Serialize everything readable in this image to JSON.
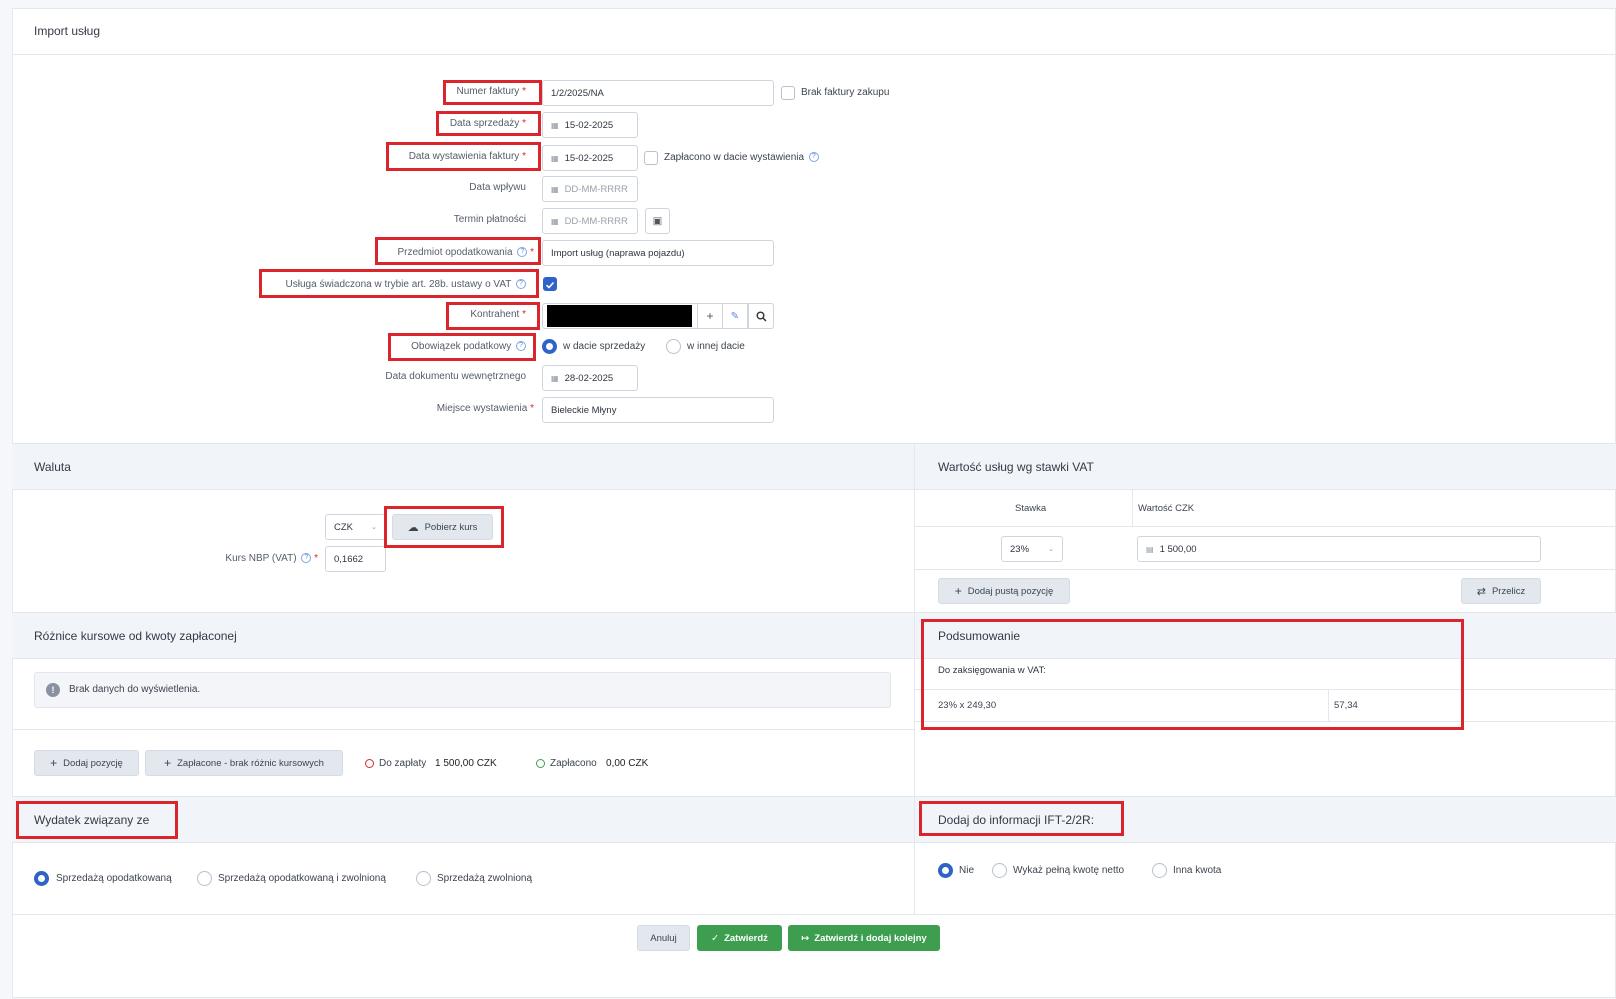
{
  "page": {
    "title": "Import usług"
  },
  "form": {
    "invoice_number": {
      "label": "Numer faktury",
      "value": "1/2/2025/NA",
      "no_invoice_label": "Brak faktury zakupu"
    },
    "sale_date": {
      "label": "Data sprzedaży",
      "value": "15-02-2025"
    },
    "issue_date": {
      "label": "Data wystawienia faktury",
      "value": "15-02-2025",
      "paid_label": "Zapłacono w dacie wystawienia"
    },
    "receipt_date": {
      "label": "Data wpływu",
      "placeholder": "DD-MM-RRRR"
    },
    "payment_term": {
      "label": "Termin płatności",
      "placeholder": "DD-MM-RRRR"
    },
    "subject": {
      "label": "Przedmiot opodatkowania",
      "value": "Import usług (naprawa pojazdu)"
    },
    "service_28b": {
      "label": "Usługa świadczona w trybie art. 28b. ustawy o VAT",
      "checked": true
    },
    "contractor": {
      "label": "Kontrahent"
    },
    "tax_obligation": {
      "label": "Obowiązek podatkowy",
      "opt1": "w dacie sprzedaży",
      "opt2": "w innej dacie",
      "selected": "w dacie sprzedaży"
    },
    "internal_doc_date": {
      "label": "Data dokumentu wewnętrznego",
      "value": "28-02-2025"
    },
    "place": {
      "label": "Miejsce wystawienia",
      "value": "Bieleckie Młyny"
    }
  },
  "currency": {
    "title": "Waluta",
    "code": "CZK",
    "fetch_label": "Pobierz kurs",
    "rate_label": "Kurs NBP (VAT)",
    "rate": "0,1662"
  },
  "vat_values": {
    "title": "Wartość usług wg stawki VAT",
    "col_rate": "Stawka",
    "col_value": "Wartość CZK",
    "rate": "23%",
    "value": "1 500,00",
    "add_label": "Dodaj pustą pozycję",
    "recalc_label": "Przelicz"
  },
  "exchange": {
    "title": "Różnice kursowe od kwoty zapłaconej",
    "empty": "Brak danych do wyświetlenia.",
    "add_label": "Dodaj pozycję",
    "paid_label": "Zapłacone - brak różnic kursowych",
    "to_pay_label": "Do zapłaty",
    "to_pay_value": "1 500,00 CZK",
    "paid_amount_label": "Zapłacono",
    "paid_amount_value": "0,00 CZK"
  },
  "summary": {
    "title": "Podsumowanie",
    "subtitle": "Do zaksięgowania w VAT:",
    "row_label": "23% x 249,30",
    "row_value": "57,34"
  },
  "expense": {
    "title": "Wydatek związany ze",
    "opt1": "Sprzedażą opodatkowaną",
    "opt2": "Sprzedażą opodatkowaną i zwolnioną",
    "opt3": "Sprzedażą zwolnioną"
  },
  "ift": {
    "title": "Dodaj do informacji IFT-2/2R:",
    "opt1": "Nie",
    "opt2": "Wykaż pełną kwotę netto",
    "opt3": "Inna kwota"
  },
  "footer": {
    "cancel": "Anuluj",
    "confirm": "Zatwierdź",
    "confirm_next": "Zatwierdź i dodaj kolejny"
  },
  "colors": {
    "accent": "#2e63c8",
    "highlight": "#d9252b",
    "green": "#3c9e4e"
  }
}
